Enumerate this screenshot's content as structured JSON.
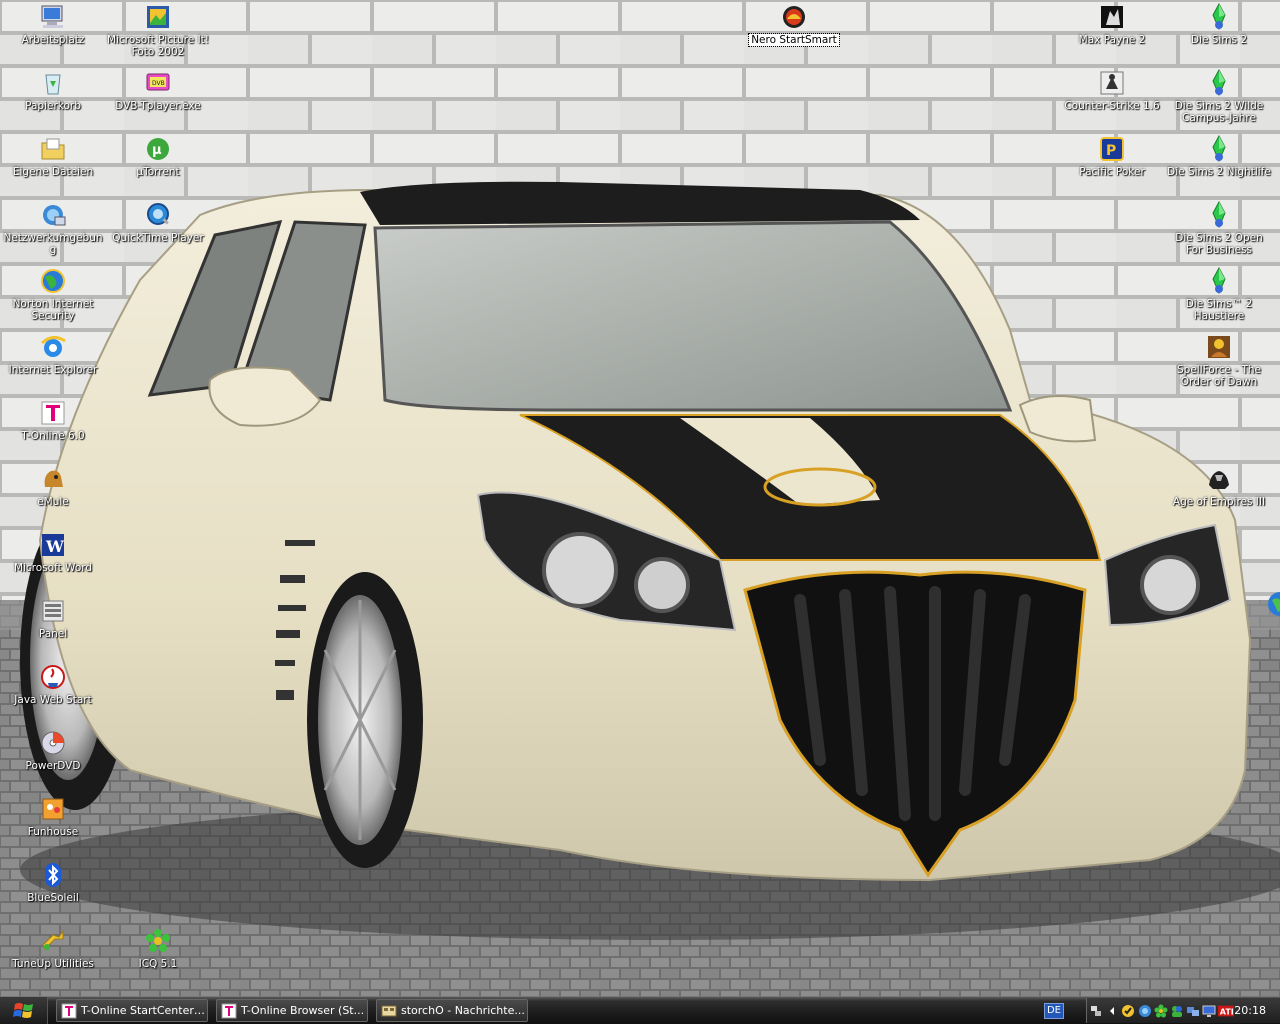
{
  "desktop": {
    "icons_left": [
      {
        "label": "Arbeitsplatz",
        "icon": "my-computer-icon"
      },
      {
        "label": "Papierkorb",
        "icon": "recycle-bin-icon"
      },
      {
        "label": "Eigene Dateien",
        "icon": "my-documents-icon"
      },
      {
        "label": "Netzwerkumgebung",
        "icon": "network-places-icon"
      },
      {
        "label": "Norton Internet Security",
        "icon": "norton-globe-icon"
      },
      {
        "label": "Internet Explorer",
        "icon": "internet-explorer-icon"
      },
      {
        "label": "T-Online 6.0",
        "icon": "t-online-icon"
      },
      {
        "label": "eMule",
        "icon": "emule-icon"
      },
      {
        "label": "Microsoft Word",
        "icon": "word-icon"
      },
      {
        "label": "Panel",
        "icon": "panel-icon"
      },
      {
        "label": "Java Web Start",
        "icon": "java-icon"
      },
      {
        "label": "PowerDVD",
        "icon": "powerdvd-icon"
      },
      {
        "label": "Funhouse",
        "icon": "funhouse-icon"
      },
      {
        "label": "BlueSoleil",
        "icon": "bluetooth-icon"
      },
      {
        "label": "TuneUp Utilities",
        "icon": "tuneup-icon"
      }
    ],
    "icons_second": [
      {
        "label": "Microsoft Picture It! Foto 2002",
        "icon": "picture-it-icon"
      },
      {
        "label": "DVB-Tplayer.exe",
        "icon": "dvb-player-icon"
      },
      {
        "label": "µTorrent",
        "icon": "utorrent-icon"
      },
      {
        "label": "QuickTime Player",
        "icon": "quicktime-icon"
      }
    ],
    "icon_icq": {
      "label": "ICQ 5.1",
      "icon": "icq-flower-icon"
    },
    "icon_nero": {
      "label": "Nero StartSmart",
      "icon": "nero-icon"
    },
    "icons_right_a": [
      {
        "label": "Max Payne 2",
        "icon": "max-payne-icon"
      },
      {
        "label": "Counter-Strike 1.6",
        "icon": "counter-strike-icon"
      },
      {
        "label": "Pacific Poker",
        "icon": "pacific-poker-icon"
      }
    ],
    "icons_right_b": [
      {
        "label": "Die Sims 2",
        "icon": "sims-icon"
      },
      {
        "label": "Die Sims 2 Wilde Campus-Jahre",
        "icon": "sims-icon"
      },
      {
        "label": "Die Sims 2 Nightlife",
        "icon": "sims-icon"
      },
      {
        "label": "Die Sims 2 Open For Business",
        "icon": "sims-icon"
      },
      {
        "label": "Die Sims™ 2 Haustiere",
        "icon": "sims-icon"
      },
      {
        "label": "SpellForce - The Order of Dawn",
        "icon": "spellforce-icon"
      },
      {
        "label": "Age of Empires III",
        "icon": "age-of-empires-icon"
      }
    ]
  },
  "taskbar": {
    "tasks": [
      {
        "label": "T-Online StartCenter ...",
        "icon": "t-online-icon"
      },
      {
        "label": "T-Online Browser (St...",
        "icon": "t-online-icon"
      },
      {
        "label": "storchO - Nachrichte...",
        "icon": "messenger-icon"
      }
    ],
    "language": "DE",
    "clock": "20:18"
  },
  "colors": {
    "brick": "#e8e8e6",
    "mortar": "#b9b9b7",
    "car_body": "#ece6cf",
    "car_black": "#1d1d1d",
    "accent_gold": "#d8a024",
    "taskbar": "#1c1c1c"
  }
}
